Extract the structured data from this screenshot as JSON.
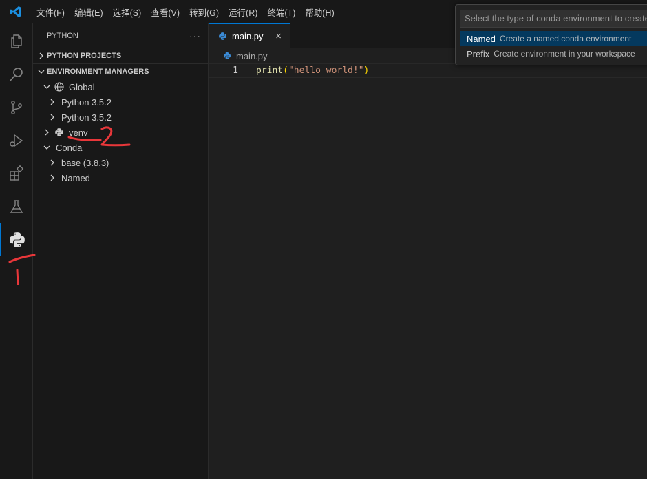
{
  "menu": [
    "文件(F)",
    "编辑(E)",
    "选择(S)",
    "查看(V)",
    "转到(G)",
    "运行(R)",
    "终端(T)",
    "帮助(H)"
  ],
  "activity_icons": [
    "explorer-icon",
    "search-icon",
    "source-control-icon",
    "run-debug-icon",
    "extensions-icon",
    "testing-icon",
    "python-icon"
  ],
  "sidebar": {
    "title": "PYTHON",
    "more": "···",
    "projects_label": "PYTHON PROJECTS",
    "env_label": "ENVIRONMENT MANAGERS",
    "tree": {
      "global": "Global",
      "py1": "Python 3.5.2",
      "py2": "Python 3.5.2",
      "venv": "venv",
      "conda": "Conda",
      "base": "base (3.8.3)",
      "named": "Named"
    }
  },
  "editor": {
    "tab_label": "main.py",
    "tab_close": "×",
    "breadcrumb": "main.py",
    "line_number": "1",
    "code": {
      "fn": "print",
      "open": "(",
      "str": "\"hello world!\"",
      "close": ")"
    }
  },
  "quickpick": {
    "placeholder": "Select the type of conda environment to create",
    "items": [
      {
        "label": "Named",
        "description": "Create a named conda environment"
      },
      {
        "label": "Prefix",
        "description": "Create environment in your workspace"
      }
    ]
  },
  "annotations": [
    "1",
    "2"
  ],
  "colors": {
    "accent": "#0078d4",
    "annotation": "#e8373a",
    "selection": "#04395e"
  }
}
